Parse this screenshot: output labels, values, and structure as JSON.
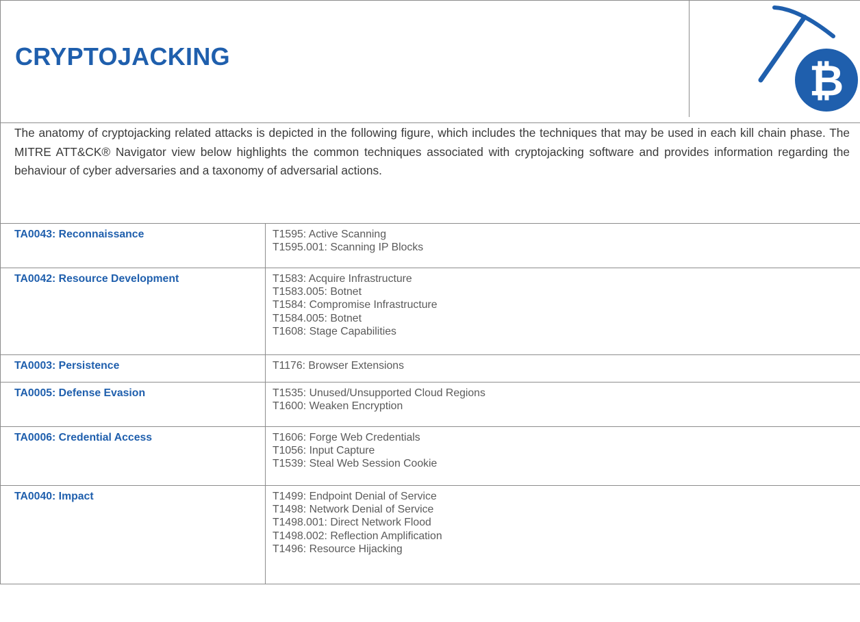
{
  "title": "CRYPTOJACKING",
  "logo": {
    "icon": "pickaxe-bitcoin-icon",
    "color": "#1f5fad",
    "symbol": "₿"
  },
  "intro": "The anatomy of cryptojacking related attacks is depicted in the following figure, which includes the techniques that may be used in each kill chain phase. The MITRE ATT&CK® Navigator view below highlights the common techniques associated with cryptojacking software and provides information regarding the behaviour of cyber adversaries and a taxonomy of adversarial actions.",
  "colors": {
    "accent": "#1f5fad",
    "body_text": "#3a3a3a",
    "technique_text": "#5a5a5a",
    "border": "#8c8c8c"
  },
  "tactics": [
    {
      "label": "TA0043: Reconnaissance",
      "techniques": [
        "T1595: Active Scanning",
        "T1595.001: Scanning IP Blocks"
      ]
    },
    {
      "label": "TA0042: Resource Development",
      "techniques": [
        "T1583: Acquire Infrastructure",
        "T1583.005: Botnet",
        "T1584: Compromise Infrastructure",
        "T1584.005: Botnet",
        "T1608: Stage Capabilities"
      ]
    },
    {
      "label": "TA0003: Persistence",
      "techniques": [
        "T1176: Browser Extensions"
      ]
    },
    {
      "label": "TA0005: Defense Evasion",
      "techniques": [
        "T1535: Unused/Unsupported Cloud Regions",
        "T1600: Weaken Encryption"
      ]
    },
    {
      "label": "TA0006: Credential Access",
      "techniques": [
        "T1606: Forge Web Credentials",
        "T1056: Input Capture",
        "T1539: Steal Web Session Cookie"
      ]
    },
    {
      "label": "TA0040: Impact",
      "techniques": [
        "T1499: Endpoint Denial of Service",
        "T1498: Network Denial of Service",
        "T1498.001: Direct Network Flood",
        "T1498.002: Reflection Amplification",
        "T1496: Resource Hijacking"
      ]
    }
  ]
}
